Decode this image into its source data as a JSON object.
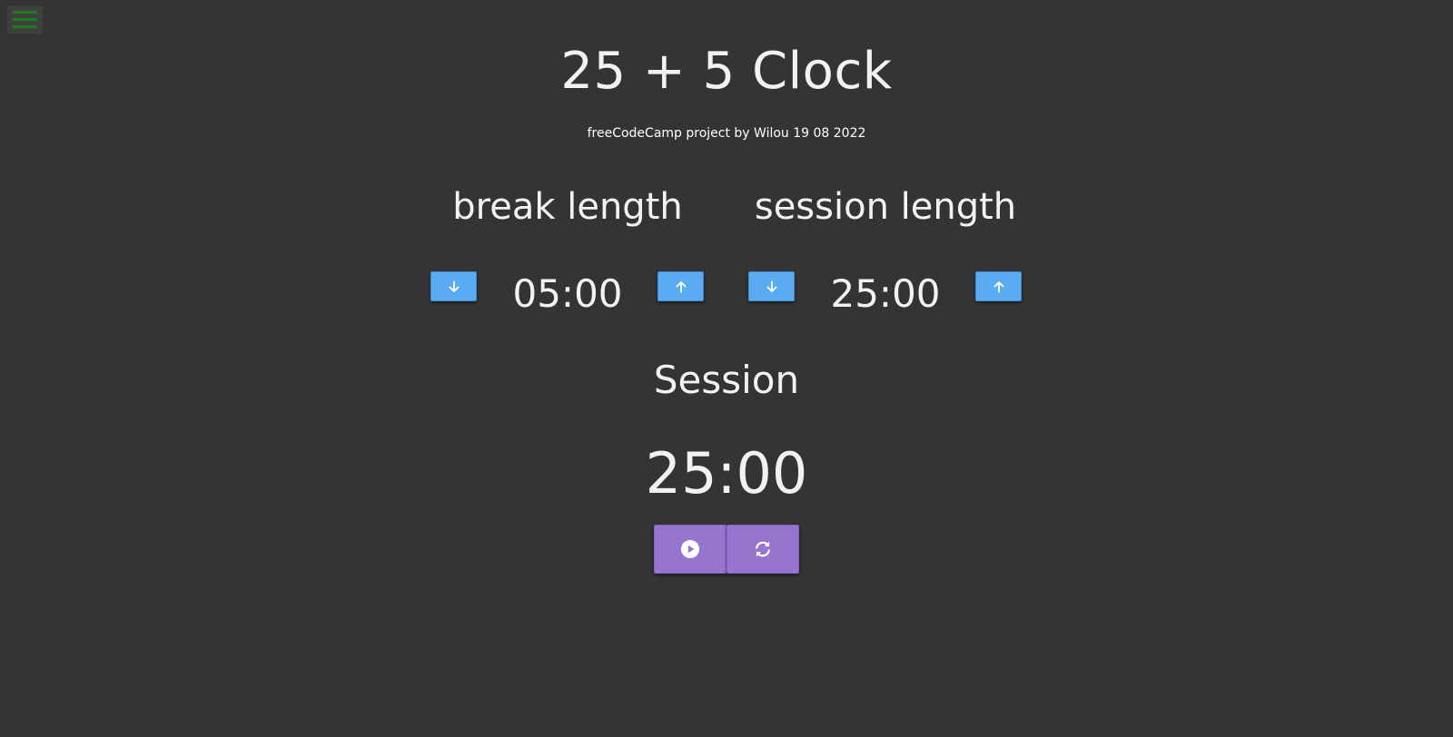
{
  "header": {
    "title": "25 + 5 Clock",
    "subtitle": "freeCodeCamp project by Wilou 19 08 2022"
  },
  "controls": {
    "break_label": "break length",
    "session_label": "session length",
    "break_length": "05:00",
    "session_length": "25:00"
  },
  "timer": {
    "label": "Session",
    "time_left": "25:00"
  },
  "icons": {
    "menu": "hamburger-menu-icon",
    "decrement": "arrow-down-icon",
    "increment": "arrow-up-icon",
    "start_stop": "play-circle-icon",
    "reset": "refresh-icon"
  },
  "colors": {
    "background": "#343434",
    "text": "#f2f2f2",
    "arrow_button": "#5aabf2",
    "control_button": "#9575cd",
    "menu_icon": "#1a7d1a"
  }
}
